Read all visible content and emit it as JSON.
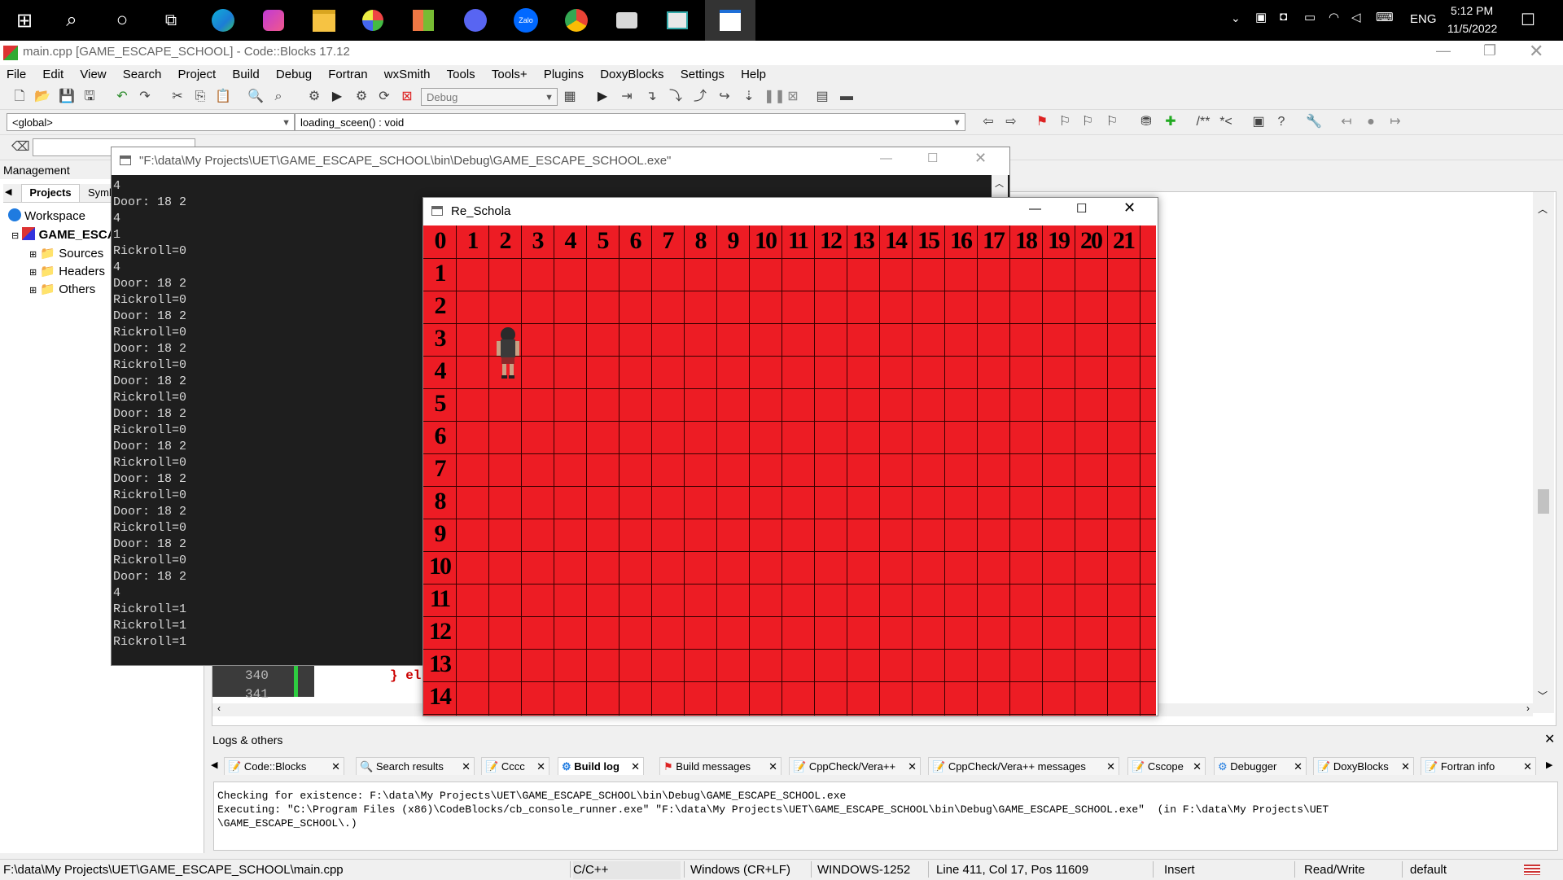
{
  "taskbar": {
    "icons": [
      "windows-icon",
      "search-icon",
      "cortana-icon",
      "taskview-icon",
      "edge-icon",
      "messenger-icon",
      "explorer-icon",
      "office-icon",
      "paint-icon",
      "discord-icon",
      "zalo-icon",
      "chrome-icon",
      "app-icon",
      "monitor-icon",
      "codeblocks-icon"
    ],
    "zalo_label": "Zalo",
    "language": "ENG",
    "time": "5:12 PM",
    "date": "11/5/2022"
  },
  "cb": {
    "title": "main.cpp [GAME_ESCAPE_SCHOOL] - Code::Blocks 17.12",
    "menu": [
      "File",
      "Edit",
      "View",
      "Search",
      "Project",
      "Build",
      "Debug",
      "Fortran",
      "wxSmith",
      "Tools",
      "Tools+",
      "Plugins",
      "DoxyBlocks",
      "Settings",
      "Help"
    ],
    "build_target": "Debug",
    "scope_combo": "<global>",
    "function_combo": "loading_sceen() : void"
  },
  "management": {
    "header": "Management",
    "tab_projects": "Projects",
    "tab_symbols": "Symb",
    "workspace": "Workspace",
    "project": "GAME_ESCA",
    "folders": [
      "Sources",
      "Headers",
      "Others"
    ]
  },
  "editor": {
    "line_numbers": [
      "340",
      "341"
    ],
    "code_fragment": "} el"
  },
  "console": {
    "title": "\"F:\\data\\My Projects\\UET\\GAME_ESCAPE_SCHOOL\\bin\\Debug\\GAME_ESCAPE_SCHOOL.exe\"",
    "lines": [
      "4",
      "Door: 18 2",
      "4",
      "1",
      "Rickroll=0",
      "4",
      "Door: 18 2",
      "Rickroll=0",
      "Door: 18 2",
      "Rickroll=0",
      "Door: 18 2",
      "Rickroll=0",
      "Door: 18 2",
      "Rickroll=0",
      "Door: 18 2",
      "Rickroll=0",
      "Door: 18 2",
      "Rickroll=0",
      "Door: 18 2",
      "Rickroll=0",
      "Door: 18 2",
      "Rickroll=0",
      "Door: 18 2",
      "Rickroll=0",
      "Door: 18 2",
      "4",
      "Rickroll=1",
      "Rickroll=1",
      "Rickroll=1"
    ]
  },
  "game": {
    "title": "Re_Schola",
    "col_labels": [
      "0",
      "1",
      "2",
      "3",
      "4",
      "5",
      "6",
      "7",
      "8",
      "9",
      "10",
      "11",
      "12",
      "13",
      "14",
      "15",
      "16",
      "17",
      "18",
      "19",
      "20",
      "21"
    ],
    "row_labels": [
      "1",
      "2",
      "3",
      "4",
      "5",
      "6",
      "7",
      "8",
      "9",
      "10",
      "11",
      "12",
      "13",
      "14"
    ],
    "grid_color": "#ed1c24",
    "player_cell": {
      "col": 2,
      "row": 3
    }
  },
  "logs": {
    "header": "Logs & others",
    "tabs": [
      "Code::Blocks",
      "Search results",
      "Cccc",
      "Build log",
      "Build messages",
      "CppCheck/Vera++",
      "CppCheck/Vera++ messages",
      "Cscope",
      "Debugger",
      "DoxyBlocks",
      "Fortran info"
    ],
    "active_tab": "Build log",
    "line1": "Checking for existence: F:\\data\\My Projects\\UET\\GAME_ESCAPE_SCHOOL\\bin\\Debug\\GAME_ESCAPE_SCHOOL.exe",
    "line2": "Executing: \"C:\\Program Files (x86)\\CodeBlocks/cb_console_runner.exe\" \"F:\\data\\My Projects\\UET\\GAME_ESCAPE_SCHOOL\\bin\\Debug\\GAME_ESCAPE_SCHOOL.exe\"  (in F:\\data\\My Projects\\UET",
    "line3": "\\GAME_ESCAPE_SCHOOL\\.)"
  },
  "status": {
    "path": "F:\\data\\My Projects\\UET\\GAME_ESCAPE_SCHOOL\\main.cpp",
    "language": "C/C++",
    "eol": "Windows (CR+LF)",
    "encoding": "WINDOWS-1252",
    "position": "Line 411, Col 17, Pos 11609",
    "mode": "Insert",
    "access": "Read/Write",
    "profile": "default"
  }
}
